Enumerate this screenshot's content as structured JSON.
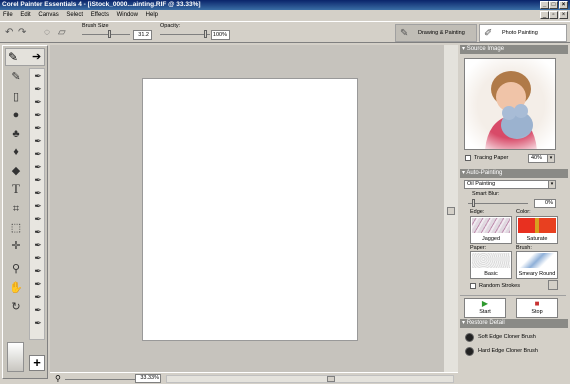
{
  "app": {
    "title": "Corel Painter Essentials 4 - [iStock_0000...ainting.RIF @ 33.33%]",
    "menu": [
      "File",
      "Edit",
      "Canvas",
      "Select",
      "Effects",
      "Window",
      "Help"
    ]
  },
  "property_bar": {
    "brush_size_label": "Brush Size",
    "brush_size_value": "31.2",
    "opacity_label": "Opacity:",
    "opacity_value": "100%",
    "tabs": [
      "Drawing & Painting",
      "Photo Painting"
    ]
  },
  "status": {
    "zoom": "33.33%"
  },
  "panel": {
    "source_image": {
      "header": "Source Image",
      "tracing_paper_label": "Tracing Paper",
      "zoom_value": "40%"
    },
    "auto_painting": {
      "header": "Auto-Painting",
      "style_value": "Oil Painting",
      "smart_blur_label": "Smart Blur:",
      "smart_blur_value": "0%",
      "edge_label": "Edge:",
      "edge_value": "Jagged",
      "color_label": "Color:",
      "color_value": "Saturate",
      "paper_label": "Paper:",
      "paper_value": "Basic",
      "brush_label": "Brush:",
      "brush_value": "Smeary Round",
      "random_strokes_label": "Random Strokes",
      "start_label": "Start",
      "stop_label": "Stop"
    },
    "restore_detail": {
      "header": "Restore Detail",
      "items": [
        "Soft Edge Cloner Brush",
        "Hard Edge Cloner Brush"
      ]
    }
  },
  "colors": {
    "title_bar": "#0a246a",
    "canvas_bg": "#c6c3bd",
    "panel_header": "#8a8a86",
    "start_green": "#2e9a2e",
    "stop_red": "#c83232"
  }
}
